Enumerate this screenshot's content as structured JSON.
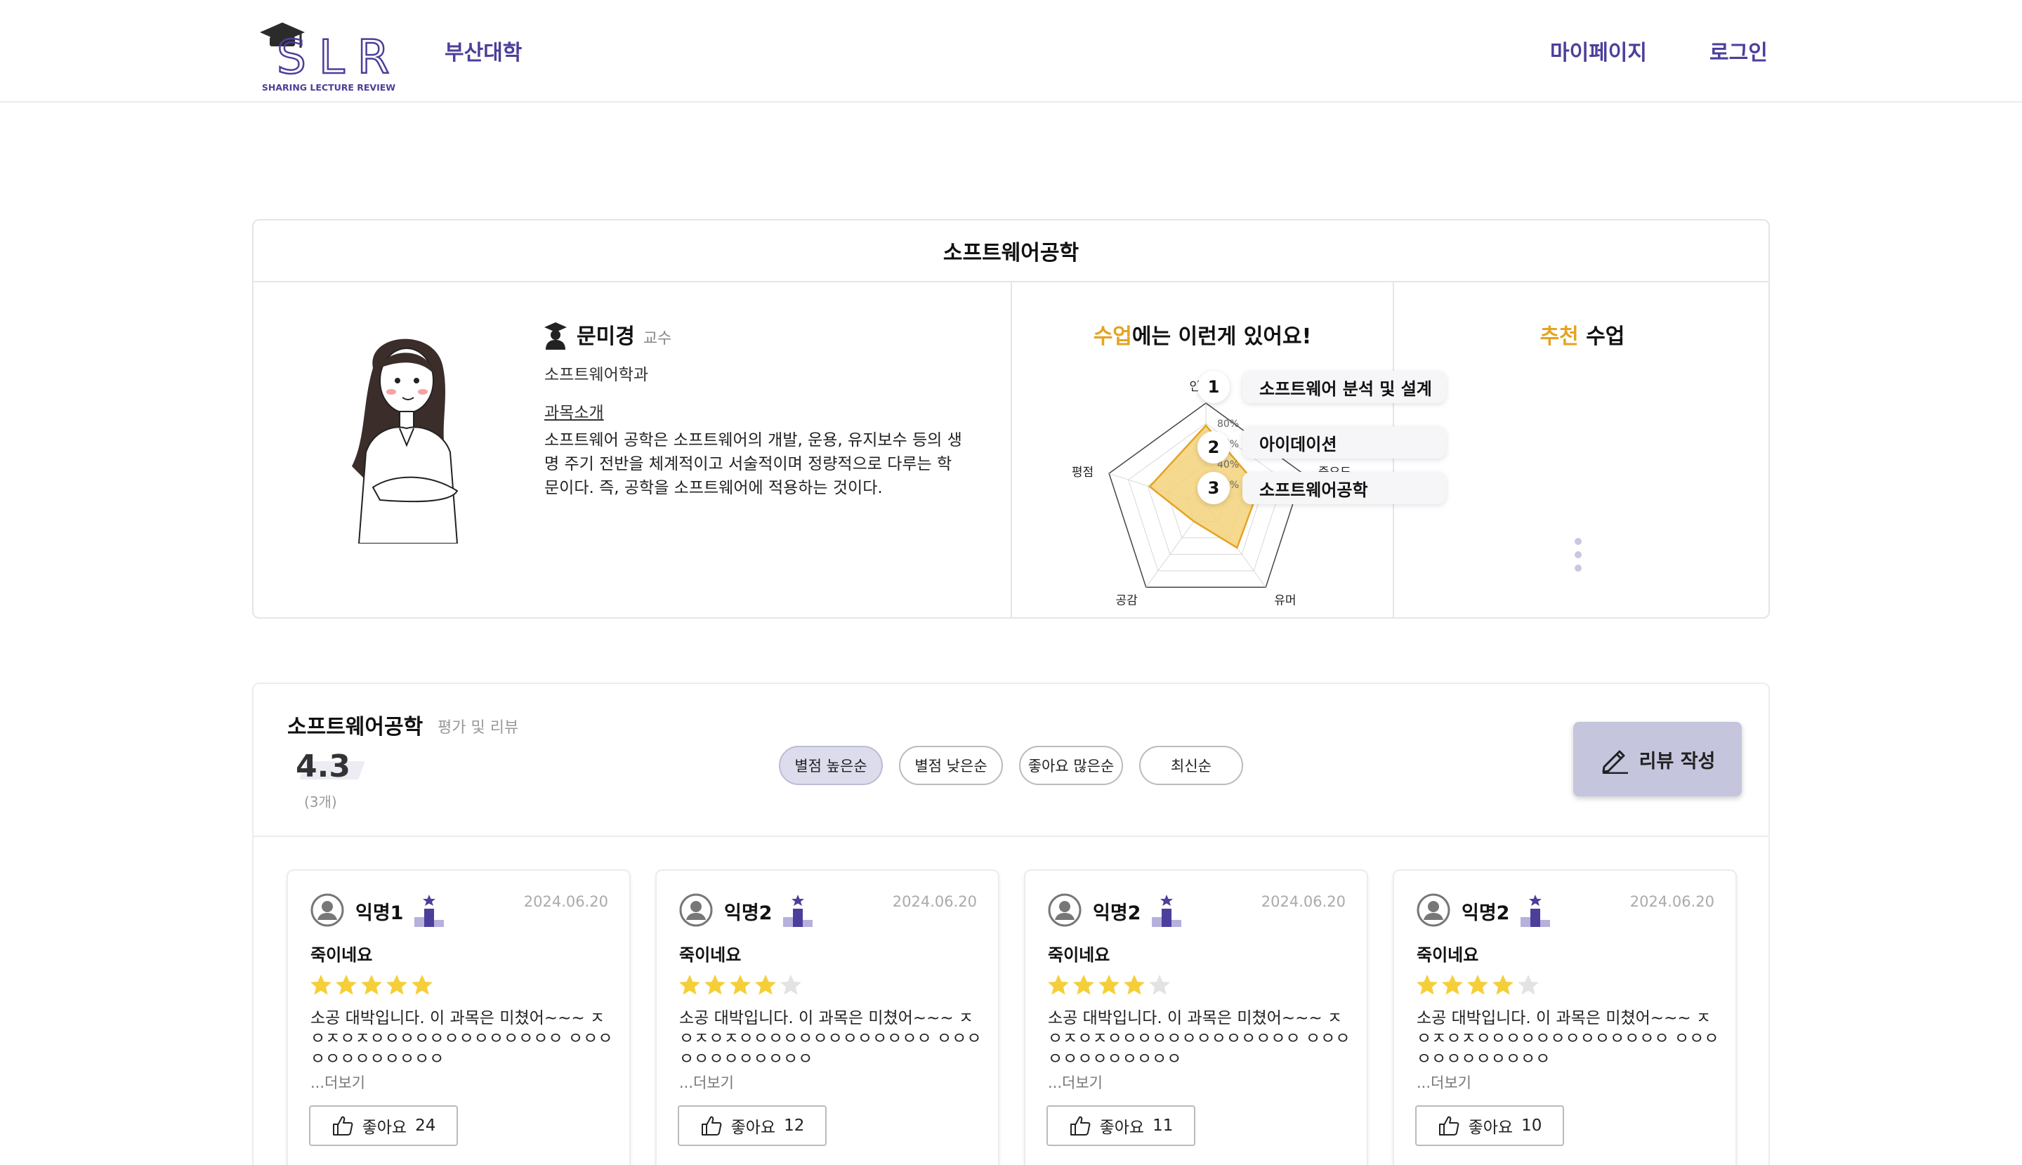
{
  "header": {
    "logo_text": "SLR",
    "logo_tagline": "SHARING LECTURE REVIEW",
    "school": "부산대학",
    "mypage": "마이페이지",
    "login": "로그인"
  },
  "course": {
    "title": "소프트웨어공학",
    "professor": {
      "name": "문미경",
      "title": "교수",
      "department": "소프트웨어학과",
      "intro_label": "과목소개",
      "intro_text": "소프트웨어 공학은 소프트웨어의 개발, 운용, 유지보수 등의 생명 주기 전반을 체계적이고 서술적이며 정량적으로 다루는 학문이다. 즉, 공학을 소프트웨어에 적용하는 것이다."
    },
    "radar": {
      "heading_accent": "수업",
      "heading_rest": "에는 이런게 있어요!",
      "axes": [
        "인기도",
        "중요도",
        "유머",
        "공감",
        "평점"
      ],
      "ring_labels": [
        "80%",
        "60%",
        "40%",
        "20%"
      ],
      "values": [
        0.78,
        0.55,
        0.52,
        0.2,
        0.58
      ],
      "accent_color": "#e5a322",
      "fill_color": "#f3d27a"
    },
    "recommend": {
      "heading_accent": "추천",
      "heading_rest": " 수업",
      "items": [
        {
          "num": "1",
          "name": "소프트웨어 분석 및 설계"
        },
        {
          "num": "2",
          "name": "아이데이션"
        },
        {
          "num": "3",
          "name": "소프트웨어공학"
        }
      ]
    }
  },
  "reviews": {
    "course": "소프트웨어공학",
    "subtitle": "평가 및 리뷰",
    "score": "4.3",
    "count": "(3개)",
    "sort": [
      "별점 높은순",
      "별점 낮은순",
      "좋아요 많은순",
      "최신순"
    ],
    "write_label": "리뷰 작성",
    "items": [
      {
        "author": "익명1",
        "date": "2024.06.20",
        "title": "죽이네요",
        "stars": 5,
        "body": "소공 대박입니다. 이 과목은 미쳤어~~~ ㅈㅇㅈㅇㅈㅇㅇㅇㅇㅇㅇㅇㅇㅇㅇㅇㅇㅇ ㅇㅇㅇㅇㅇㅇㅇㅇㅇㅇㅇㅇ",
        "more": "...더보기",
        "like_label": "좋아요",
        "likes": "24"
      },
      {
        "author": "익명2",
        "date": "2024.06.20",
        "title": "죽이네요",
        "stars": 4,
        "body": "소공 대박입니다. 이 과목은 미쳤어~~~ ㅈㅇㅈㅇㅈㅇㅇㅇㅇㅇㅇㅇㅇㅇㅇㅇㅇㅇ ㅇㅇㅇㅇㅇㅇㅇㅇㅇㅇㅇㅇ",
        "more": "...더보기",
        "like_label": "좋아요",
        "likes": "12"
      },
      {
        "author": "익명2",
        "date": "2024.06.20",
        "title": "죽이네요",
        "stars": 4,
        "body": "소공 대박입니다. 이 과목은 미쳤어~~~ ㅈㅇㅈㅇㅈㅇㅇㅇㅇㅇㅇㅇㅇㅇㅇㅇㅇㅇ ㅇㅇㅇㅇㅇㅇㅇㅇㅇㅇㅇㅇ",
        "more": "...더보기",
        "like_label": "좋아요",
        "likes": "11"
      },
      {
        "author": "익명2",
        "date": "2024.06.20",
        "title": "죽이네요",
        "stars": 4,
        "body": "소공 대박입니다. 이 과목은 미쳤어~~~ ㅈㅇㅈㅇㅈㅇㅇㅇㅇㅇㅇㅇㅇㅇㅇㅇㅇㅇ ㅇㅇㅇㅇㅇㅇㅇㅇㅇㅇㅇㅇ",
        "more": "...더보기",
        "like_label": "좋아요",
        "likes": "10"
      }
    ]
  },
  "colors": {
    "brand": "#4b3f9b",
    "star_on": "#f5cf3a",
    "star_off": "#e3e3e3"
  }
}
